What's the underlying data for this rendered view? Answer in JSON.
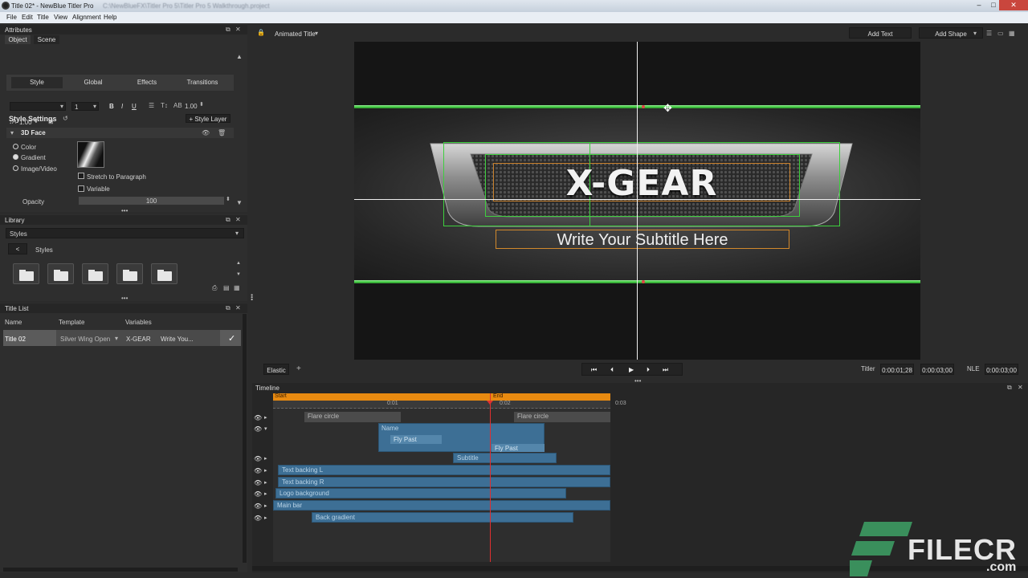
{
  "window": {
    "title": "Title 02* - NewBlue Titler Pro",
    "path_hint": "C:\\NewBlueFX\\Titler Pro 5\\Titler Pro 5 Walkthrough.project"
  },
  "menu": [
    "File",
    "Edit",
    "Title",
    "View",
    "Alignment",
    "Help"
  ],
  "attributes": {
    "header": "Attributes",
    "subtabs": [
      "Object",
      "Scene"
    ],
    "tabs": [
      "Style",
      "Global",
      "Effects",
      "Transitions"
    ],
    "font_size": "1",
    "spacing_value": "1.00",
    "line_value": "1.00",
    "style_settings_label": "Style Settings",
    "style_layer_label": "+ Style Layer",
    "face_label": "3D Face",
    "fill_options": [
      "Color",
      "Gradient",
      "Image/Video"
    ],
    "selected_fill": "Gradient",
    "stretch_label": "Stretch to Paragraph",
    "variable_label": "Variable",
    "opacity_label": "Opacity",
    "opacity_value": "100"
  },
  "library": {
    "header": "Library",
    "dropdown": "Styles",
    "back": "<",
    "folder_label": "Styles"
  },
  "title_list": {
    "header": "Title List",
    "columns": [
      "Name",
      "Template",
      "Variables"
    ],
    "row": {
      "name": "Title 02",
      "template": "Silver Wing Open",
      "var1": "X-GEAR",
      "var2": "Write You..."
    }
  },
  "canvas": {
    "mode_dropdown": "Animated Title",
    "add_text": "Add Text",
    "add_shape": "Add Shape",
    "main_text": "X-GEAR",
    "subtitle": "Write Your Subtitle Here",
    "style_tab": "Elastic"
  },
  "transport": {
    "titler_label": "Titler",
    "current_time": "0:00:01;28",
    "duration": "0:00:03;00",
    "nle_label": "NLE",
    "nle_time": "0:00:03;00"
  },
  "timeline": {
    "header": "Timeline",
    "start": "Start",
    "end": "End",
    "ticks": [
      "0:01",
      "0:02",
      "0:03"
    ],
    "tracks": [
      "Flare circle",
      "Flare circle",
      "Name",
      "Fly Past",
      "Fly Past",
      "Subtitle",
      "Text backing L",
      "Text backing R",
      "Logo background",
      "Main bar",
      "Back gradient"
    ]
  },
  "watermark": {
    "brand": "FILECR",
    "suffix": ".com"
  },
  "colors": {
    "accent_orange": "#e88a10",
    "track_blue": "#3d6f95",
    "guide_green": "#46d246"
  }
}
